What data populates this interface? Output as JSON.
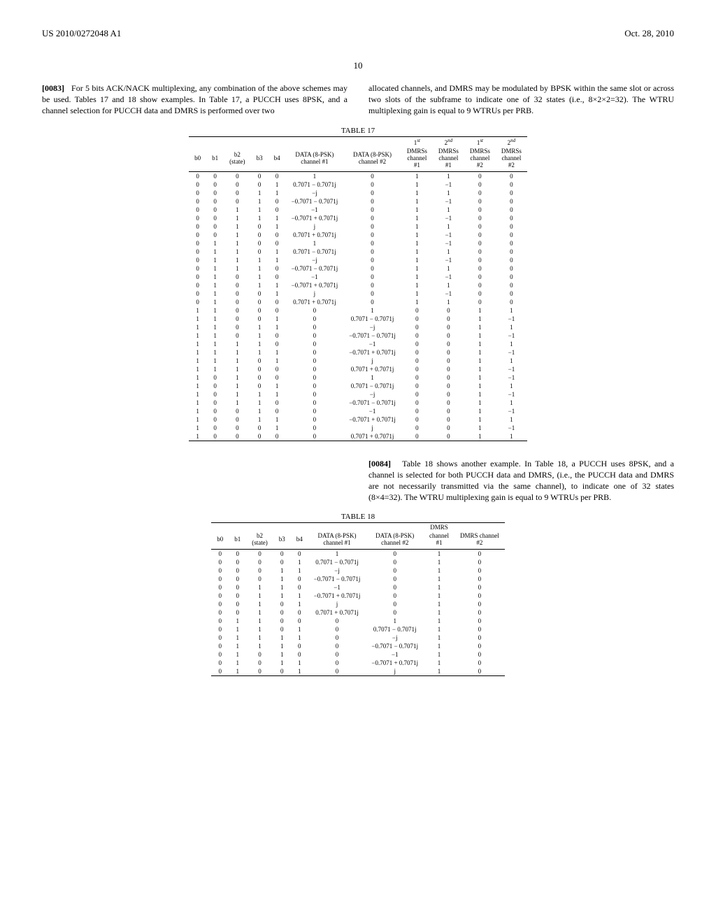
{
  "header": {
    "left": "US 2010/0272048 A1",
    "right": "Oct. 28, 2010"
  },
  "pagenum": "10",
  "p83": {
    "num": "[0083]",
    "text": "For 5 bits ACK/NACK multiplexing, any combination of the above schemes may be used. Tables 17 and 18 show examples. In Table 17, a PUCCH uses 8PSK, and a channel selection for PUCCH data and DMRS is performed over two"
  },
  "p83b": "allocated channels, and DMRS may be modulated by BPSK within the same slot or across two slots of the subframe to indicate one of 32 states (i.e., 8×2×2=32). The WTRU multiplexing gain is equal to 9 WTRUs per PRB.",
  "t17": {
    "caption": "TABLE 17",
    "headers": [
      "b0",
      "b1",
      "b2\n(state)",
      "b3",
      "b4",
      "DATA (8-PSK)\nchannel #1",
      "DATA (8-PSK)\nchannel #2",
      "1",
      "DMRSs\nchannel\n#1",
      "2",
      "DMRSs\nchannel\n#1",
      "1",
      "DMRSs\nchannel\n#2",
      "2",
      "DMRSs\nchannel\n#2"
    ],
    "rows": [
      [
        "0",
        "0",
        "0",
        "0",
        "0",
        "1",
        "0",
        "1",
        "1",
        "0",
        "0"
      ],
      [
        "0",
        "0",
        "0",
        "0",
        "1",
        "0.7071 − 0.7071j",
        "0",
        "1",
        "−1",
        "0",
        "0"
      ],
      [
        "0",
        "0",
        "0",
        "1",
        "1",
        "−j",
        "0",
        "1",
        "1",
        "0",
        "0"
      ],
      [
        "0",
        "0",
        "0",
        "1",
        "0",
        "−0.7071 − 0.7071j",
        "0",
        "1",
        "−1",
        "0",
        "0"
      ],
      [
        "0",
        "0",
        "1",
        "1",
        "0",
        "−1",
        "0",
        "1",
        "1",
        "0",
        "0"
      ],
      [
        "0",
        "0",
        "1",
        "1",
        "1",
        "−0.7071 + 0.7071j",
        "0",
        "1",
        "−1",
        "0",
        "0"
      ],
      [
        "0",
        "0",
        "1",
        "0",
        "1",
        "j",
        "0",
        "1",
        "1",
        "0",
        "0"
      ],
      [
        "0",
        "0",
        "1",
        "0",
        "0",
        "0.7071 + 0.7071j",
        "0",
        "1",
        "−1",
        "0",
        "0"
      ],
      [
        "0",
        "1",
        "1",
        "0",
        "0",
        "1",
        "0",
        "1",
        "−1",
        "0",
        "0"
      ],
      [
        "0",
        "1",
        "1",
        "0",
        "1",
        "0.7071 − 0.7071j",
        "0",
        "1",
        "1",
        "0",
        "0"
      ],
      [
        "0",
        "1",
        "1",
        "1",
        "1",
        "−j",
        "0",
        "1",
        "−1",
        "0",
        "0"
      ],
      [
        "0",
        "1",
        "1",
        "1",
        "0",
        "−0.7071 − 0.7071j",
        "0",
        "1",
        "1",
        "0",
        "0"
      ],
      [
        "0",
        "1",
        "0",
        "1",
        "0",
        "−1",
        "0",
        "1",
        "−1",
        "0",
        "0"
      ],
      [
        "0",
        "1",
        "0",
        "1",
        "1",
        "−0.7071 + 0.7071j",
        "0",
        "1",
        "1",
        "0",
        "0"
      ],
      [
        "0",
        "1",
        "0",
        "0",
        "1",
        "j",
        "0",
        "1",
        "−1",
        "0",
        "0"
      ],
      [
        "0",
        "1",
        "0",
        "0",
        "0",
        "0.7071 + 0.7071j",
        "0",
        "1",
        "1",
        "0",
        "0"
      ],
      [
        "1",
        "1",
        "0",
        "0",
        "0",
        "0",
        "1",
        "0",
        "0",
        "1",
        "1"
      ],
      [
        "1",
        "1",
        "0",
        "0",
        "1",
        "0",
        "0.7071 − 0.7071j",
        "0",
        "0",
        "1",
        "−1"
      ],
      [
        "1",
        "1",
        "0",
        "1",
        "1",
        "0",
        "−j",
        "0",
        "0",
        "1",
        "1"
      ],
      [
        "1",
        "1",
        "0",
        "1",
        "0",
        "0",
        "−0.7071 − 0.7071j",
        "0",
        "0",
        "1",
        "−1"
      ],
      [
        "1",
        "1",
        "1",
        "1",
        "0",
        "0",
        "−1",
        "0",
        "0",
        "1",
        "1"
      ],
      [
        "1",
        "1",
        "1",
        "1",
        "1",
        "0",
        "−0.7071 + 0.7071j",
        "0",
        "0",
        "1",
        "−1"
      ],
      [
        "1",
        "1",
        "1",
        "0",
        "1",
        "0",
        "j",
        "0",
        "0",
        "1",
        "1"
      ],
      [
        "1",
        "1",
        "1",
        "0",
        "0",
        "0",
        "0.7071 + 0.7071j",
        "0",
        "0",
        "1",
        "−1"
      ],
      [
        "1",
        "0",
        "1",
        "0",
        "0",
        "0",
        "1",
        "0",
        "0",
        "1",
        "−1"
      ],
      [
        "1",
        "0",
        "1",
        "0",
        "1",
        "0",
        "0.7071 − 0.7071j",
        "0",
        "0",
        "1",
        "1"
      ],
      [
        "1",
        "0",
        "1",
        "1",
        "1",
        "0",
        "−j",
        "0",
        "0",
        "1",
        "−1"
      ],
      [
        "1",
        "0",
        "1",
        "1",
        "0",
        "0",
        "−0.7071 − 0.7071j",
        "0",
        "0",
        "1",
        "1"
      ],
      [
        "1",
        "0",
        "0",
        "1",
        "0",
        "0",
        "−1",
        "0",
        "0",
        "1",
        "−1"
      ],
      [
        "1",
        "0",
        "0",
        "1",
        "1",
        "0",
        "−0.7071 + 0.7071j",
        "0",
        "0",
        "1",
        "1"
      ],
      [
        "1",
        "0",
        "0",
        "0",
        "1",
        "0",
        "j",
        "0",
        "0",
        "1",
        "−1"
      ],
      [
        "1",
        "0",
        "0",
        "0",
        "0",
        "0",
        "0.7071 + 0.7071j",
        "0",
        "0",
        "1",
        "1"
      ]
    ]
  },
  "p84": {
    "num": "[0084]",
    "text": "Table 18 shows another example. In Table 18, a PUCCH uses 8PSK, and a channel is selected for both PUCCH data and DMRS, (i.e., the PUCCH data and DMRS are not necessarily transmitted via the same channel), to indicate one of 32 states (8×4=32). The WTRU multiplexing gain is equal to 9 WTRUs per PRB."
  },
  "t18": {
    "caption": "TABLE 18",
    "headers": [
      "b0",
      "b1",
      "b2\n(state)",
      "b3",
      "b4",
      "DATA (8-PSK)\nchannel #1",
      "DATA (8-PSK)\nchannel #2",
      "DMRS\nchannel\n#1",
      "DMRS channel\n#2"
    ],
    "rows": [
      [
        "0",
        "0",
        "0",
        "0",
        "0",
        "1",
        "0",
        "1",
        "0"
      ],
      [
        "0",
        "0",
        "0",
        "0",
        "1",
        "0.7071 − 0.7071j",
        "0",
        "1",
        "0"
      ],
      [
        "0",
        "0",
        "0",
        "1",
        "1",
        "−j",
        "0",
        "1",
        "0"
      ],
      [
        "0",
        "0",
        "0",
        "1",
        "0",
        "−0.7071 − 0.7071j",
        "0",
        "1",
        "0"
      ],
      [
        "0",
        "0",
        "1",
        "1",
        "0",
        "−1",
        "0",
        "1",
        "0"
      ],
      [
        "0",
        "0",
        "1",
        "1",
        "1",
        "−0.7071 + 0.7071j",
        "0",
        "1",
        "0"
      ],
      [
        "0",
        "0",
        "1",
        "0",
        "1",
        "j",
        "0",
        "1",
        "0"
      ],
      [
        "0",
        "0",
        "1",
        "0",
        "0",
        "0.7071 + 0.7071j",
        "0",
        "1",
        "0"
      ],
      [
        "0",
        "1",
        "1",
        "0",
        "0",
        "0",
        "1",
        "1",
        "0"
      ],
      [
        "0",
        "1",
        "1",
        "0",
        "1",
        "0",
        "0.7071 − 0.7071j",
        "1",
        "0"
      ],
      [
        "0",
        "1",
        "1",
        "1",
        "1",
        "0",
        "−j",
        "1",
        "0"
      ],
      [
        "0",
        "1",
        "1",
        "1",
        "0",
        "0",
        "−0.7071 − 0.7071j",
        "1",
        "0"
      ],
      [
        "0",
        "1",
        "0",
        "1",
        "0",
        "0",
        "−1",
        "1",
        "0"
      ],
      [
        "0",
        "1",
        "0",
        "1",
        "1",
        "0",
        "−0.7071 + 0.7071j",
        "1",
        "0"
      ],
      [
        "0",
        "1",
        "0",
        "0",
        "1",
        "0",
        "j",
        "1",
        "0"
      ]
    ]
  }
}
